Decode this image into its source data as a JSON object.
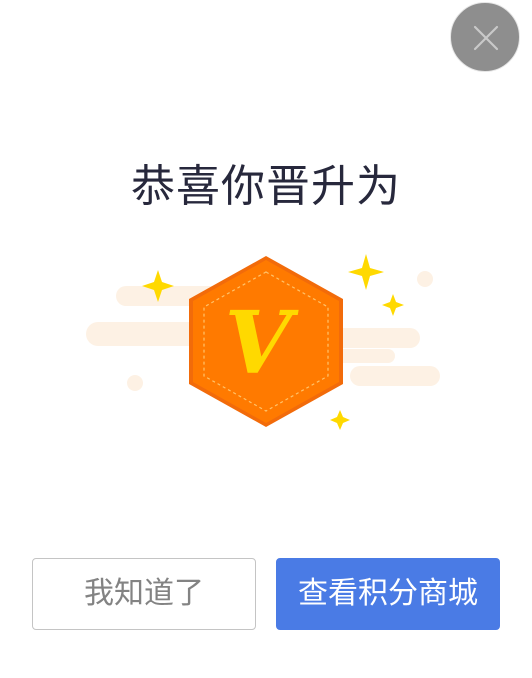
{
  "dialog": {
    "title": "恭喜你晋升为",
    "badge_letter": "V",
    "buttons": {
      "dismiss_label": "我知道了",
      "view_mall_label": "查看积分商城"
    },
    "close_icon": "close-icon"
  },
  "colors": {
    "title_text": "#27283c",
    "badge_orange": "#ff7a00",
    "badge_border": "#f26b0a",
    "badge_letter": "#ffd900",
    "sparkle": "#ffd900",
    "cloud": "#fdf1e4",
    "close_bg": "#8e8e8e",
    "primary_button": "#4a7be5",
    "secondary_text": "#838383",
    "secondary_border": "#c4c4c4"
  }
}
